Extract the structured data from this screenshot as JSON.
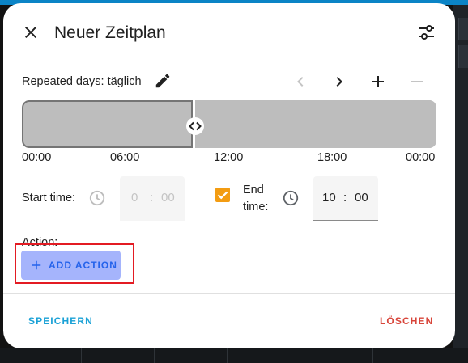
{
  "dialog": {
    "title": "Neuer Zeitplan",
    "icons": {
      "close": "close-icon",
      "settings": "tune-icon",
      "edit": "pencil-icon",
      "prev": "chevron-left-icon",
      "next": "chevron-right-icon",
      "add": "plus-icon",
      "remove": "minus-icon",
      "resize": "resize-arrows-icon",
      "clock": "clock-icon"
    }
  },
  "repeat": {
    "label": "Repeated days: täglich"
  },
  "timeline": {
    "ticks": [
      "00:00",
      "06:00",
      "12:00",
      "18:00",
      "00:00"
    ]
  },
  "start": {
    "label": "Start time:",
    "hours": "0",
    "separator": ":",
    "minutes": "00",
    "enabled": false
  },
  "end": {
    "label_line1": "End",
    "label_line2": "time:",
    "checked": true,
    "hours": "10",
    "separator": ":",
    "minutes": "00"
  },
  "action": {
    "label": "Action:",
    "add_button": "ADD ACTION"
  },
  "footer": {
    "save": "SPEICHERN",
    "delete": "LÖSCHEN"
  },
  "colors": {
    "accent": "#1aa1d6",
    "danger": "#d8453a",
    "checkbox": "#f39c12",
    "add_button_bg": "#a5b4fc",
    "add_button_text": "#2563eb",
    "highlight": "#e31b23",
    "timeline": "#bdbdbd"
  }
}
